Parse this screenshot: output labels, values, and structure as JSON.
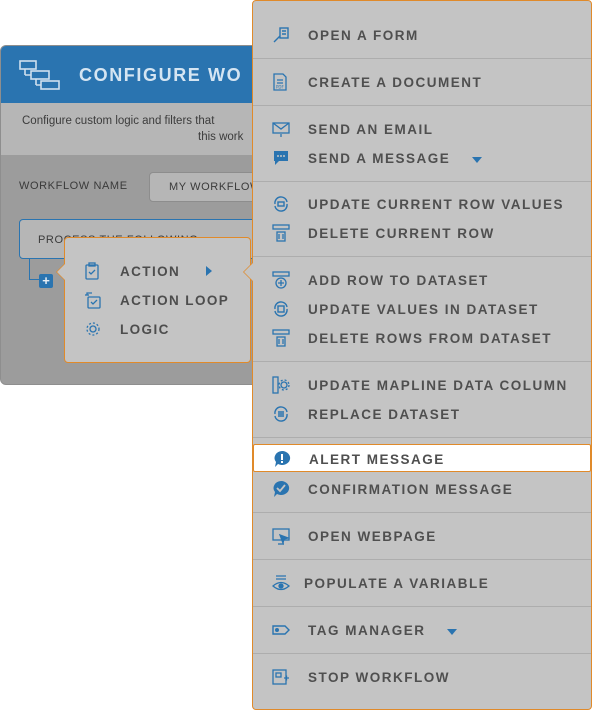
{
  "dialog": {
    "title": "CONFIGURE WO",
    "description_line1": "Configure custom logic and filters that",
    "description_line2": "this work",
    "workflow_name_label": "WORKFLOW NAME",
    "workflow_name_value": "MY WORKFLOW",
    "process_label": "PROCESS THE FOLLOWING",
    "add_icon": "plus-icon",
    "header_icon": "workflow-diagram-icon"
  },
  "submenu": {
    "items": [
      {
        "label": "ACTION",
        "icon": "clipboard-icon",
        "has_submenu": true
      },
      {
        "label": "ACTION LOOP",
        "icon": "loop-check-icon"
      },
      {
        "label": "LOGIC",
        "icon": "logic-gear-icon"
      }
    ]
  },
  "menu": {
    "items": [
      {
        "label": "OPEN A FORM",
        "icon": "form-pen-icon"
      },
      {
        "label": "CREATE A DOCUMENT",
        "icon": "pdf-document-icon"
      },
      {
        "label": "SEND AN EMAIL",
        "icon": "envelope-icon"
      },
      {
        "label": "SEND A MESSAGE",
        "icon": "chat-bubble-icon",
        "has_dropdown": true
      },
      {
        "label": "UPDATE CURRENT ROW VALUES",
        "icon": "row-refresh-icon"
      },
      {
        "label": "DELETE CURRENT ROW",
        "icon": "row-delete-icon"
      },
      {
        "label": "ADD ROW TO DATASET",
        "icon": "row-add-icon"
      },
      {
        "label": "UPDATE VALUES IN DATASET",
        "icon": "dataset-refresh-icon"
      },
      {
        "label": "DELETE ROWS FROM DATASET",
        "icon": "rows-delete-icon"
      },
      {
        "label": "UPDATE MAPLINE DATA COLUMN",
        "icon": "column-gear-icon"
      },
      {
        "label": "REPLACE DATASET",
        "icon": "dataset-replace-icon"
      },
      {
        "label": "ALERT MESSAGE",
        "icon": "alert-bubble-icon",
        "highlighted": true
      },
      {
        "label": "CONFIRMATION MESSAGE",
        "icon": "confirm-bubble-icon"
      },
      {
        "label": "OPEN WEBPAGE",
        "icon": "monitor-cursor-icon"
      },
      {
        "label": "POPULATE A VARIABLE",
        "icon": "variable-eye-icon"
      },
      {
        "label": "TAG MANAGER",
        "icon": "tag-icon",
        "has_dropdown": true
      },
      {
        "label": "STOP WORKFLOW",
        "icon": "stop-workflow-icon"
      }
    ]
  },
  "colors": {
    "accent": "#2a74b0",
    "highlight_border": "#e08a2a",
    "overlay_gray": "#c4c4c4"
  }
}
